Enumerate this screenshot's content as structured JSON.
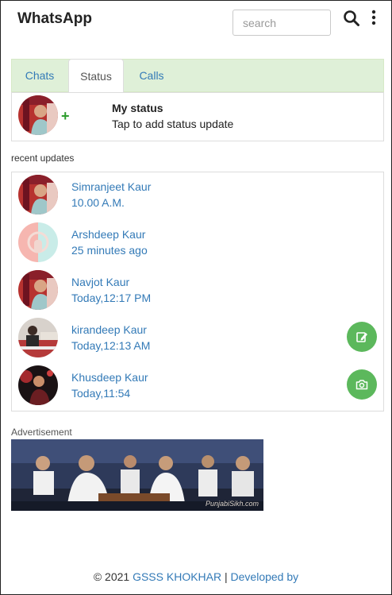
{
  "header": {
    "app_title": "WhatsApp",
    "search_placeholder": "search"
  },
  "tabs": [
    {
      "label": "Chats",
      "active": false
    },
    {
      "label": "Status",
      "active": true
    },
    {
      "label": "Calls",
      "active": false
    }
  ],
  "my_status": {
    "title": "My status",
    "subtitle": "Tap to add status update",
    "plus": "+"
  },
  "recent": {
    "label": "recent updates",
    "items": [
      {
        "name": "Simranjeet Kaur",
        "time": "10.00 A.M."
      },
      {
        "name": "Arshdeep Kaur",
        "time": "25 minutes ago"
      },
      {
        "name": "Navjot Kaur",
        "time": "Today,12:17 PM"
      },
      {
        "name": "kirandeep Kaur",
        "time": "Today,12:13 AM"
      },
      {
        "name": "Khusdeep Kaur",
        "time": "Today,11:54"
      }
    ]
  },
  "fabs": [
    {
      "icon": "pencil-icon"
    },
    {
      "icon": "camera-icon"
    }
  ],
  "ad": {
    "label": "Advertisement",
    "watermark": "PunjabiSikh.com"
  },
  "footer": {
    "copyright": "© 2021",
    "school": "GSSS KHOKHAR",
    "separator": "|",
    "developed": "Developed by"
  },
  "colors": {
    "link": "#337ab7",
    "tab_bar": "#dff0d8",
    "fab": "#5cb85c",
    "plus": "#2e9d2e"
  }
}
